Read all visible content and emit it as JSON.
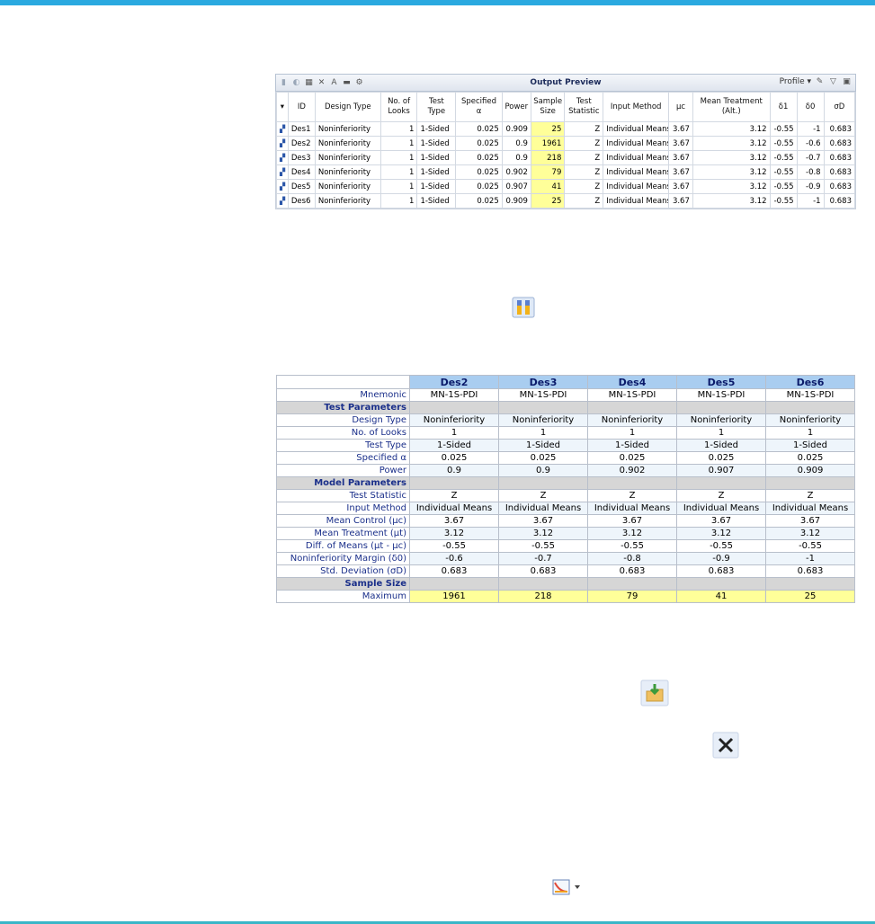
{
  "output_preview": {
    "title": "Output Preview",
    "profile_label": "Profile",
    "columns": [
      "ID",
      "Design Type",
      "No. of Looks",
      "Test Type",
      "Specified α",
      "Power",
      "Sample Size",
      "Test Statistic",
      "Input Method",
      "μc",
      "Mean Treatment (Alt.)",
      "δ1",
      "δ0",
      "σD"
    ],
    "rows": [
      [
        "Des1",
        "Noninferiority",
        "1",
        "1-Sided",
        "0.025",
        "0.909",
        "25",
        "Z",
        "Individual Means",
        "3.67",
        "3.12",
        "-0.55",
        "-1",
        "0.683"
      ],
      [
        "Des2",
        "Noninferiority",
        "1",
        "1-Sided",
        "0.025",
        "0.9",
        "1961",
        "Z",
        "Individual Means",
        "3.67",
        "3.12",
        "-0.55",
        "-0.6",
        "0.683"
      ],
      [
        "Des3",
        "Noninferiority",
        "1",
        "1-Sided",
        "0.025",
        "0.9",
        "218",
        "Z",
        "Individual Means",
        "3.67",
        "3.12",
        "-0.55",
        "-0.7",
        "0.683"
      ],
      [
        "Des4",
        "Noninferiority",
        "1",
        "1-Sided",
        "0.025",
        "0.902",
        "79",
        "Z",
        "Individual Means",
        "3.67",
        "3.12",
        "-0.55",
        "-0.8",
        "0.683"
      ],
      [
        "Des5",
        "Noninferiority",
        "1",
        "1-Sided",
        "0.025",
        "0.907",
        "41",
        "Z",
        "Individual Means",
        "3.67",
        "3.12",
        "-0.55",
        "-0.9",
        "0.683"
      ],
      [
        "Des6",
        "Noninferiority",
        "1",
        "1-Sided",
        "0.025",
        "0.909",
        "25",
        "Z",
        "Individual Means",
        "3.67",
        "3.12",
        "-0.55",
        "-1",
        "0.683"
      ]
    ]
  },
  "comparison": {
    "headers": [
      "Des2",
      "Des3",
      "Des4",
      "Des5",
      "Des6"
    ],
    "rows": [
      {
        "kind": "data",
        "label": "Mnemonic",
        "values": [
          "MN-1S-PDI",
          "MN-1S-PDI",
          "MN-1S-PDI",
          "MN-1S-PDI",
          "MN-1S-PDI"
        ]
      },
      {
        "kind": "section",
        "label": "Test Parameters"
      },
      {
        "kind": "data",
        "label": "Design Type",
        "values": [
          "Noninferiority",
          "Noninferiority",
          "Noninferiority",
          "Noninferiority",
          "Noninferiority"
        ]
      },
      {
        "kind": "data",
        "label": "No. of Looks",
        "values": [
          "1",
          "1",
          "1",
          "1",
          "1"
        ]
      },
      {
        "kind": "data",
        "label": "Test Type",
        "values": [
          "1-Sided",
          "1-Sided",
          "1-Sided",
          "1-Sided",
          "1-Sided"
        ]
      },
      {
        "kind": "data",
        "label": "Specified α",
        "values": [
          "0.025",
          "0.025",
          "0.025",
          "0.025",
          "0.025"
        ]
      },
      {
        "kind": "data",
        "label": "Power",
        "values": [
          "0.9",
          "0.9",
          "0.902",
          "0.907",
          "0.909"
        ]
      },
      {
        "kind": "section",
        "label": "Model Parameters"
      },
      {
        "kind": "data",
        "label": "Test Statistic",
        "values": [
          "Z",
          "Z",
          "Z",
          "Z",
          "Z"
        ]
      },
      {
        "kind": "data",
        "label": "Input Method",
        "values": [
          "Individual Means",
          "Individual Means",
          "Individual Means",
          "Individual Means",
          "Individual Means"
        ]
      },
      {
        "kind": "data",
        "label": "Mean Control (μc)",
        "values": [
          "3.67",
          "3.67",
          "3.67",
          "3.67",
          "3.67"
        ]
      },
      {
        "kind": "data",
        "label": "Mean Treatment (μt)",
        "values": [
          "3.12",
          "3.12",
          "3.12",
          "3.12",
          "3.12"
        ]
      },
      {
        "kind": "data",
        "label": "Diff. of Means (μt - μc)",
        "values": [
          "-0.55",
          "-0.55",
          "-0.55",
          "-0.55",
          "-0.55"
        ]
      },
      {
        "kind": "data",
        "label": "Noninferiority Margin (δ0)",
        "values": [
          "-0.6",
          "-0.7",
          "-0.8",
          "-0.9",
          "-1"
        ]
      },
      {
        "kind": "data",
        "label": "Std. Deviation (σD)",
        "values": [
          "0.683",
          "0.683",
          "0.683",
          "0.683",
          "0.683"
        ]
      },
      {
        "kind": "section",
        "label": "Sample Size"
      },
      {
        "kind": "max",
        "label": "Maximum",
        "values": [
          "1961",
          "218",
          "79",
          "41",
          "25"
        ]
      }
    ]
  },
  "colors": {
    "accent_bar": "#2aa9e0",
    "header_blue": "#a9cdf0",
    "highlight_yellow": "#ffff99",
    "section_gray": "#d6d6d6"
  },
  "icons": {
    "display_details": "display-details-icon",
    "save_to_workbook": "save-to-workbook-icon",
    "close": "close-icon",
    "plots": "plots-icon"
  }
}
